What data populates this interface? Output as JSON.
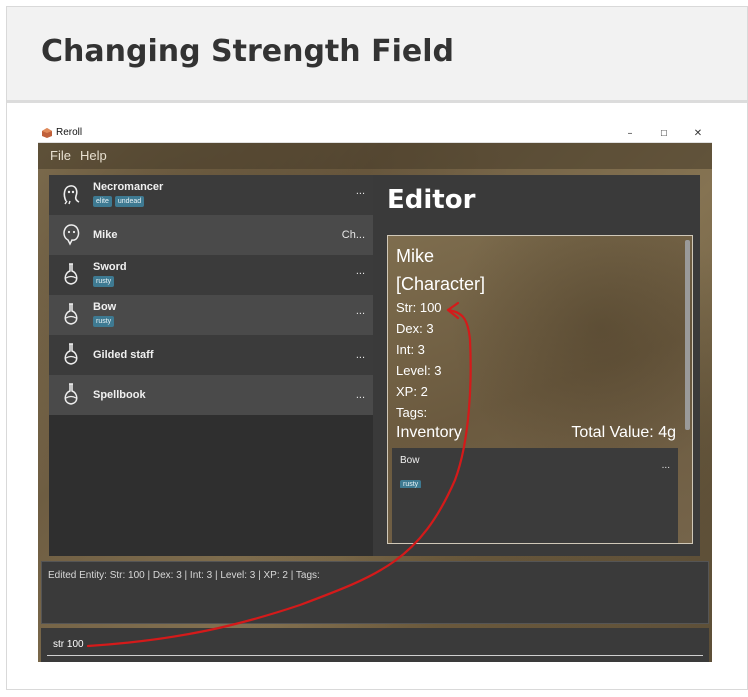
{
  "doc": {
    "title": "Changing Strength Field"
  },
  "window": {
    "title": "Reroll",
    "minimize": "–",
    "maximize": "☐",
    "close": "✕"
  },
  "menu": {
    "file": "File",
    "help": "Help"
  },
  "entities": [
    {
      "name": "Necromancer",
      "tags": [
        "elite",
        "undead"
      ],
      "right": "...",
      "icon": "ghost-icon"
    },
    {
      "name": "Mike",
      "tags": [],
      "right": "Ch...",
      "icon": "ghost-icon"
    },
    {
      "name": "Sword",
      "tags": [
        "rusty"
      ],
      "right": "...",
      "icon": "potion-icon"
    },
    {
      "name": "Bow",
      "tags": [
        "rusty"
      ],
      "right": "...",
      "icon": "potion-icon"
    },
    {
      "name": "Gilded staff",
      "tags": [],
      "right": "...",
      "icon": "potion-icon"
    },
    {
      "name": "Spellbook",
      "tags": [],
      "right": "...",
      "icon": "potion-icon"
    }
  ],
  "editor": {
    "heading": "Editor",
    "name": "Mike",
    "type": "[Character]",
    "str": "Str: 100",
    "dex": "Dex: 3",
    "int": "Int: 3",
    "level": "Level: 3",
    "xp": "XP: 2",
    "tags": "Tags:",
    "inventory_label": "Inventory",
    "total_value": "Total Value: 4g",
    "inventory": [
      {
        "name": "Bow",
        "tags": [
          "rusty"
        ],
        "right": "..."
      }
    ]
  },
  "result": {
    "text": "Edited Entity: Str: 100 | Dex: 3 | Int: 3 | Level: 3 | XP: 2 | Tags:"
  },
  "command": {
    "value": "str 100"
  },
  "colors": {
    "tag": "#3e7a92",
    "annotation": "#d41a1a",
    "panel": "#3a3a3a"
  }
}
